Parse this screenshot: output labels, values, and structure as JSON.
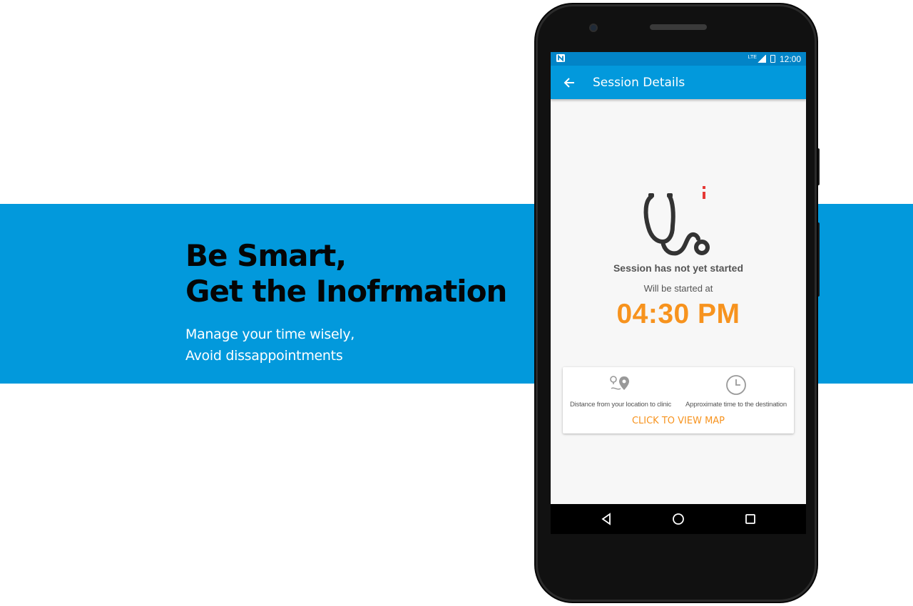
{
  "promo": {
    "headline_line1": "Be Smart,",
    "headline_line2": "Get the Inofrmation",
    "sub_line1": "Manage your time wisely,",
    "sub_line2": "Avoid dissappointments"
  },
  "status_bar": {
    "left_icon": "notification-n-icon",
    "network": "LTE",
    "time": "12:00"
  },
  "app_bar": {
    "back_icon": "arrow-back-icon",
    "title": "Session Details"
  },
  "session": {
    "icon": "stethoscope-icon",
    "status": "Session has not yet started",
    "will_start_label": "Will be started at",
    "start_time": "04:30 PM"
  },
  "info_card": {
    "distance_icon": "location-route-icon",
    "distance_label": "Distance from your location to clinic",
    "time_icon": "clock-icon",
    "time_label": "Approximate time to the destination",
    "map_link": "CLICK TO VIEW MAP"
  },
  "nav_bar": {
    "back": "triangle-back-icon",
    "home": "circle-home-icon",
    "recents": "square-recents-icon"
  },
  "colors": {
    "brand_blue": "#0299dc",
    "accent_orange": "#f7931e",
    "badge_red": "#e53935"
  }
}
